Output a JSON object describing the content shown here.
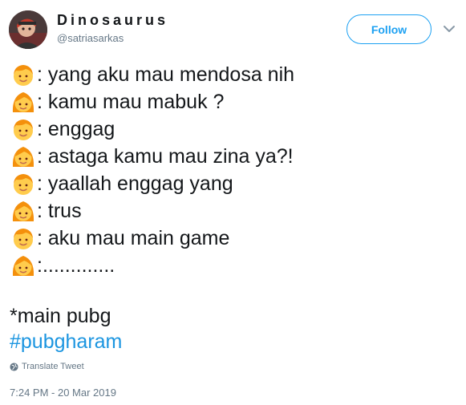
{
  "author": {
    "display_name": "Dinosaurus",
    "handle": "@satriasarkas"
  },
  "header": {
    "follow_label": "Follow"
  },
  "dialogue": [
    {
      "speaker": "boy-emoji",
      "text": ": yang aku mau mendosa nih"
    },
    {
      "speaker": "girl-emoji",
      "text": ": kamu mau mabuk ?"
    },
    {
      "speaker": "boy-emoji",
      "text": ": enggag"
    },
    {
      "speaker": "girl-emoji",
      "text": ": astaga kamu mau zina ya?!"
    },
    {
      "speaker": "boy-emoji",
      "text": ": yaallah enggag yang"
    },
    {
      "speaker": "girl-emoji",
      "text": ": trus"
    },
    {
      "speaker": "boy-emoji",
      "text": ": aku mau main game"
    },
    {
      "speaker": "girl-emoji",
      "text": ":............."
    }
  ],
  "footnote": "*main pubg",
  "hashtag": "#pubgharam",
  "translate_label": "Translate Tweet",
  "timestamp": "7:24 PM - 20 Mar 2019",
  "colors": {
    "accent": "#1da1f2",
    "hashtag": "#1b95e0",
    "muted": "#657786",
    "text": "#14171a"
  }
}
